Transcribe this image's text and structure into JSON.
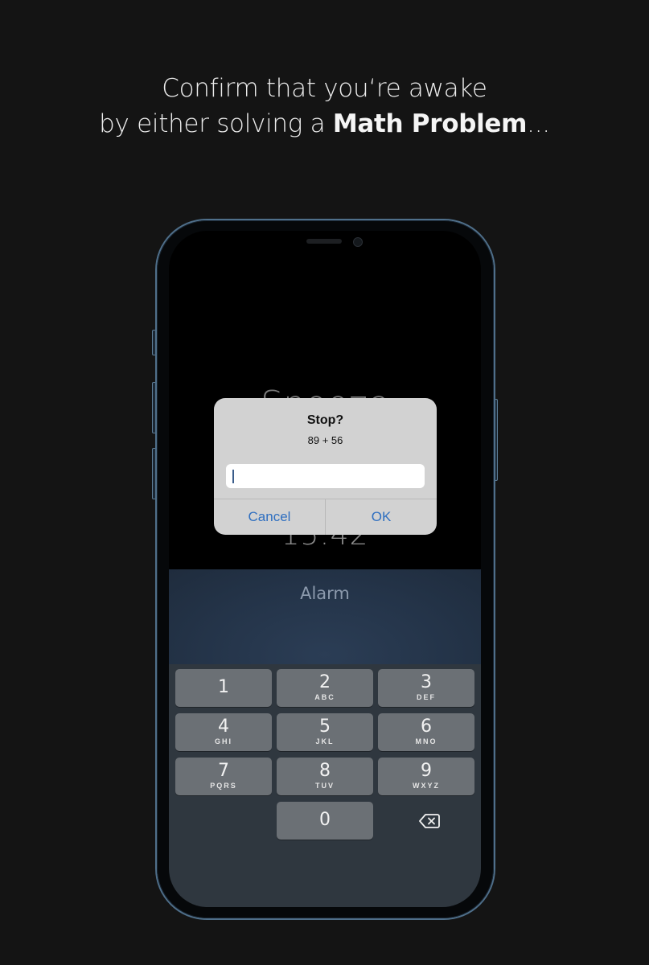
{
  "headline": {
    "line1": "Confirm that you‘re awake",
    "line2_prefix": "by either solving a ",
    "line2_bold": "Math Problem",
    "line2_suffix": "..."
  },
  "phone": {
    "background_title": "Snooze",
    "background_time": "15:42",
    "alarm_label": "Alarm"
  },
  "dialog": {
    "title": "Stop?",
    "message": "89 + 56",
    "input_value": "",
    "cancel_label": "Cancel",
    "ok_label": "OK",
    "accent_color": "#2f6fc0"
  },
  "keypad": {
    "keys": [
      {
        "num": "1",
        "letters": ""
      },
      {
        "num": "2",
        "letters": "ABC"
      },
      {
        "num": "3",
        "letters": "DEF"
      },
      {
        "num": "4",
        "letters": "GHI"
      },
      {
        "num": "5",
        "letters": "JKL"
      },
      {
        "num": "6",
        "letters": "MNO"
      },
      {
        "num": "7",
        "letters": "PQRS"
      },
      {
        "num": "8",
        "letters": "TUV"
      },
      {
        "num": "9",
        "letters": "WXYZ"
      },
      {
        "num": "0",
        "letters": ""
      }
    ],
    "backspace_icon": "delete-left-icon"
  }
}
